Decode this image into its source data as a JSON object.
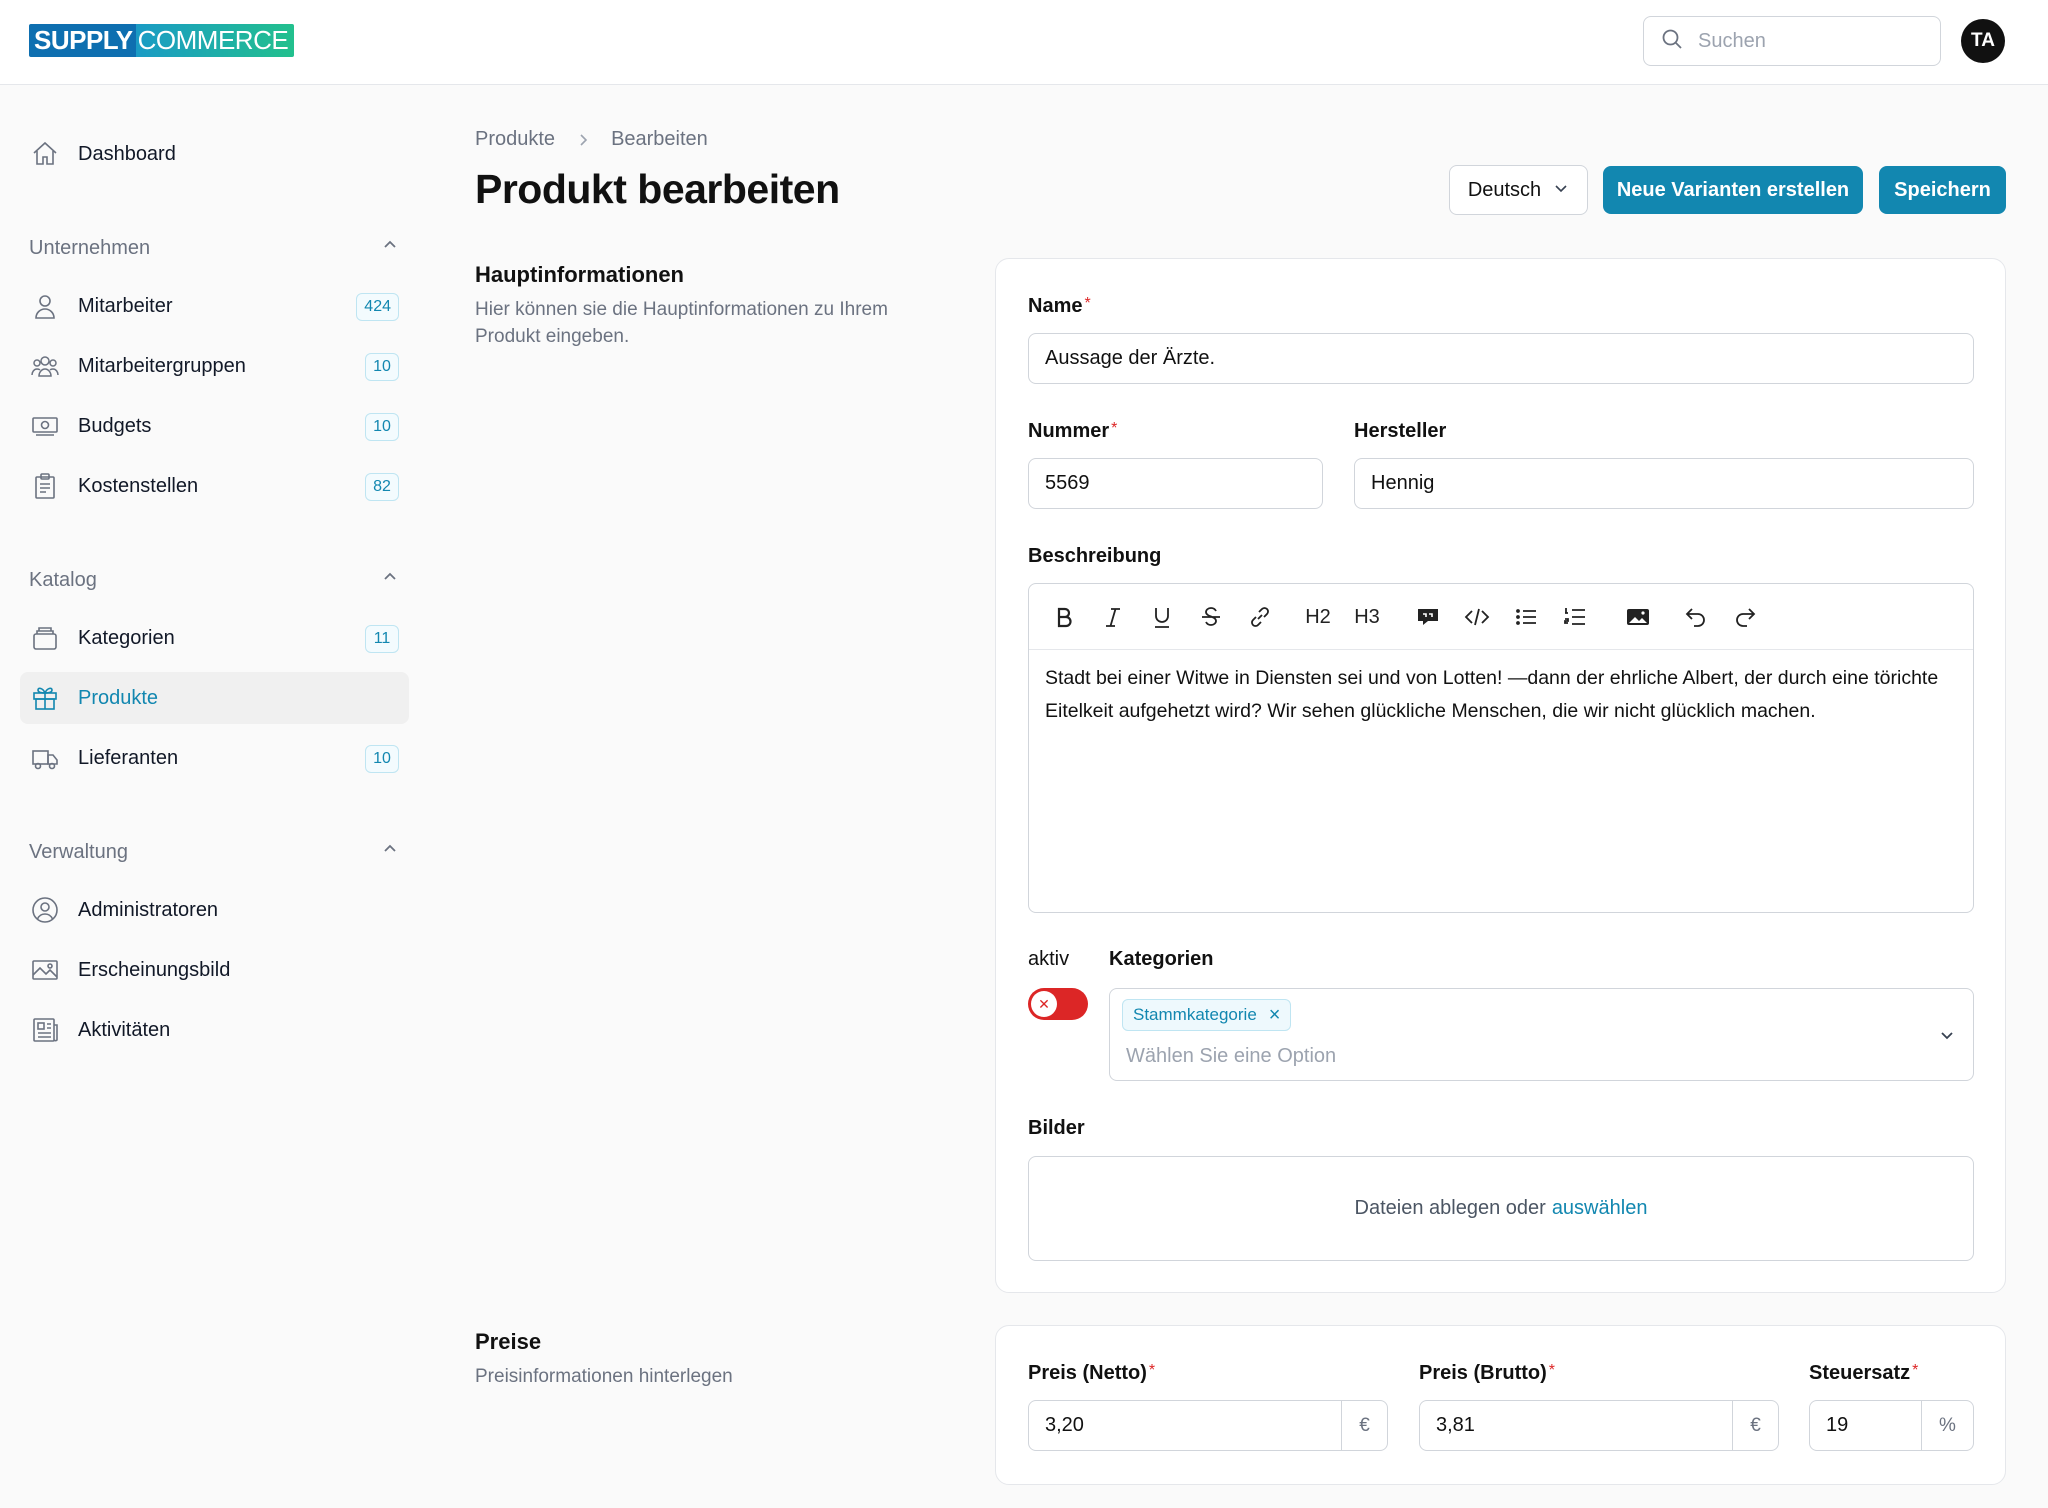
{
  "app": {
    "logo_part1": "SUPPLY",
    "logo_part2": "COMMERCE",
    "brand_color": "#1287b0"
  },
  "header": {
    "search_placeholder": "Suchen",
    "avatar_initials": "TA"
  },
  "sidebar": {
    "dashboard": {
      "label": "Dashboard",
      "icon": "home-icon"
    },
    "sections": [
      {
        "title": "Unternehmen",
        "items": [
          {
            "label": "Mitarbeiter",
            "count": "424",
            "icon": "user-icon"
          },
          {
            "label": "Mitarbeitergruppen",
            "count": "10",
            "icon": "users-icon"
          },
          {
            "label": "Budgets",
            "count": "10",
            "icon": "banknote-icon"
          },
          {
            "label": "Kostenstellen",
            "count": "82",
            "icon": "clipboard-icon"
          }
        ]
      },
      {
        "title": "Katalog",
        "items": [
          {
            "label": "Kategorien",
            "count": "11",
            "icon": "folder-icon"
          },
          {
            "label": "Produkte",
            "count": "",
            "icon": "gift-icon",
            "active": true
          },
          {
            "label": "Lieferanten",
            "count": "10",
            "icon": "truck-icon"
          }
        ]
      },
      {
        "title": "Verwaltung",
        "items": [
          {
            "label": "Administratoren",
            "icon": "user-circle-icon"
          },
          {
            "label": "Erscheinungsbild",
            "icon": "image-icon"
          },
          {
            "label": "Aktivitäten",
            "icon": "newspaper-icon"
          }
        ]
      }
    ]
  },
  "main": {
    "breadcrumb": [
      "Produkte",
      "Bearbeiten"
    ],
    "title": "Produkt bearbeiten",
    "language": "Deutsch",
    "btn_variants": "Neue Varianten erstellen",
    "btn_save": "Speichern",
    "main_info": {
      "title": "Hauptinformationen",
      "description": "Hier können sie die Hauptinformationen zu Ihrem Produkt eingeben.",
      "name_label": "Name",
      "name_value": "Aussage der Ärzte.",
      "number_label": "Nummer",
      "number_value": "5569",
      "manufacturer_label": "Hersteller",
      "manufacturer_value": "Hennig",
      "description_label": "Beschreibung",
      "description_text": "Stadt bei einer Witwe in Diensten sei und von Lotten! —dann der ehrliche Albert, der durch eine törichte Eitelkeit aufgehetzt wird? Wir sehen glückliche Menschen, die wir nicht glücklich machen.",
      "toolbar": {
        "h2": "H2",
        "h3": "H3"
      },
      "active_label": "aktiv",
      "active_state": false,
      "categories_label": "Kategorien",
      "category_chip": "Stammkategorie",
      "categories_placeholder": "Wählen Sie eine Option",
      "images_label": "Bilder",
      "dropzone_text": "Dateien ablegen oder",
      "dropzone_link": "auswählen"
    },
    "prices": {
      "title": "Preise",
      "description": "Preisinformationen hinterlegen",
      "net_label": "Preis (Netto)",
      "net_value": "3,20",
      "gross_label": "Preis (Brutto)",
      "gross_value": "3,81",
      "currency": "€",
      "tax_label": "Steuersatz",
      "tax_value": "19",
      "percent": "%"
    }
  }
}
